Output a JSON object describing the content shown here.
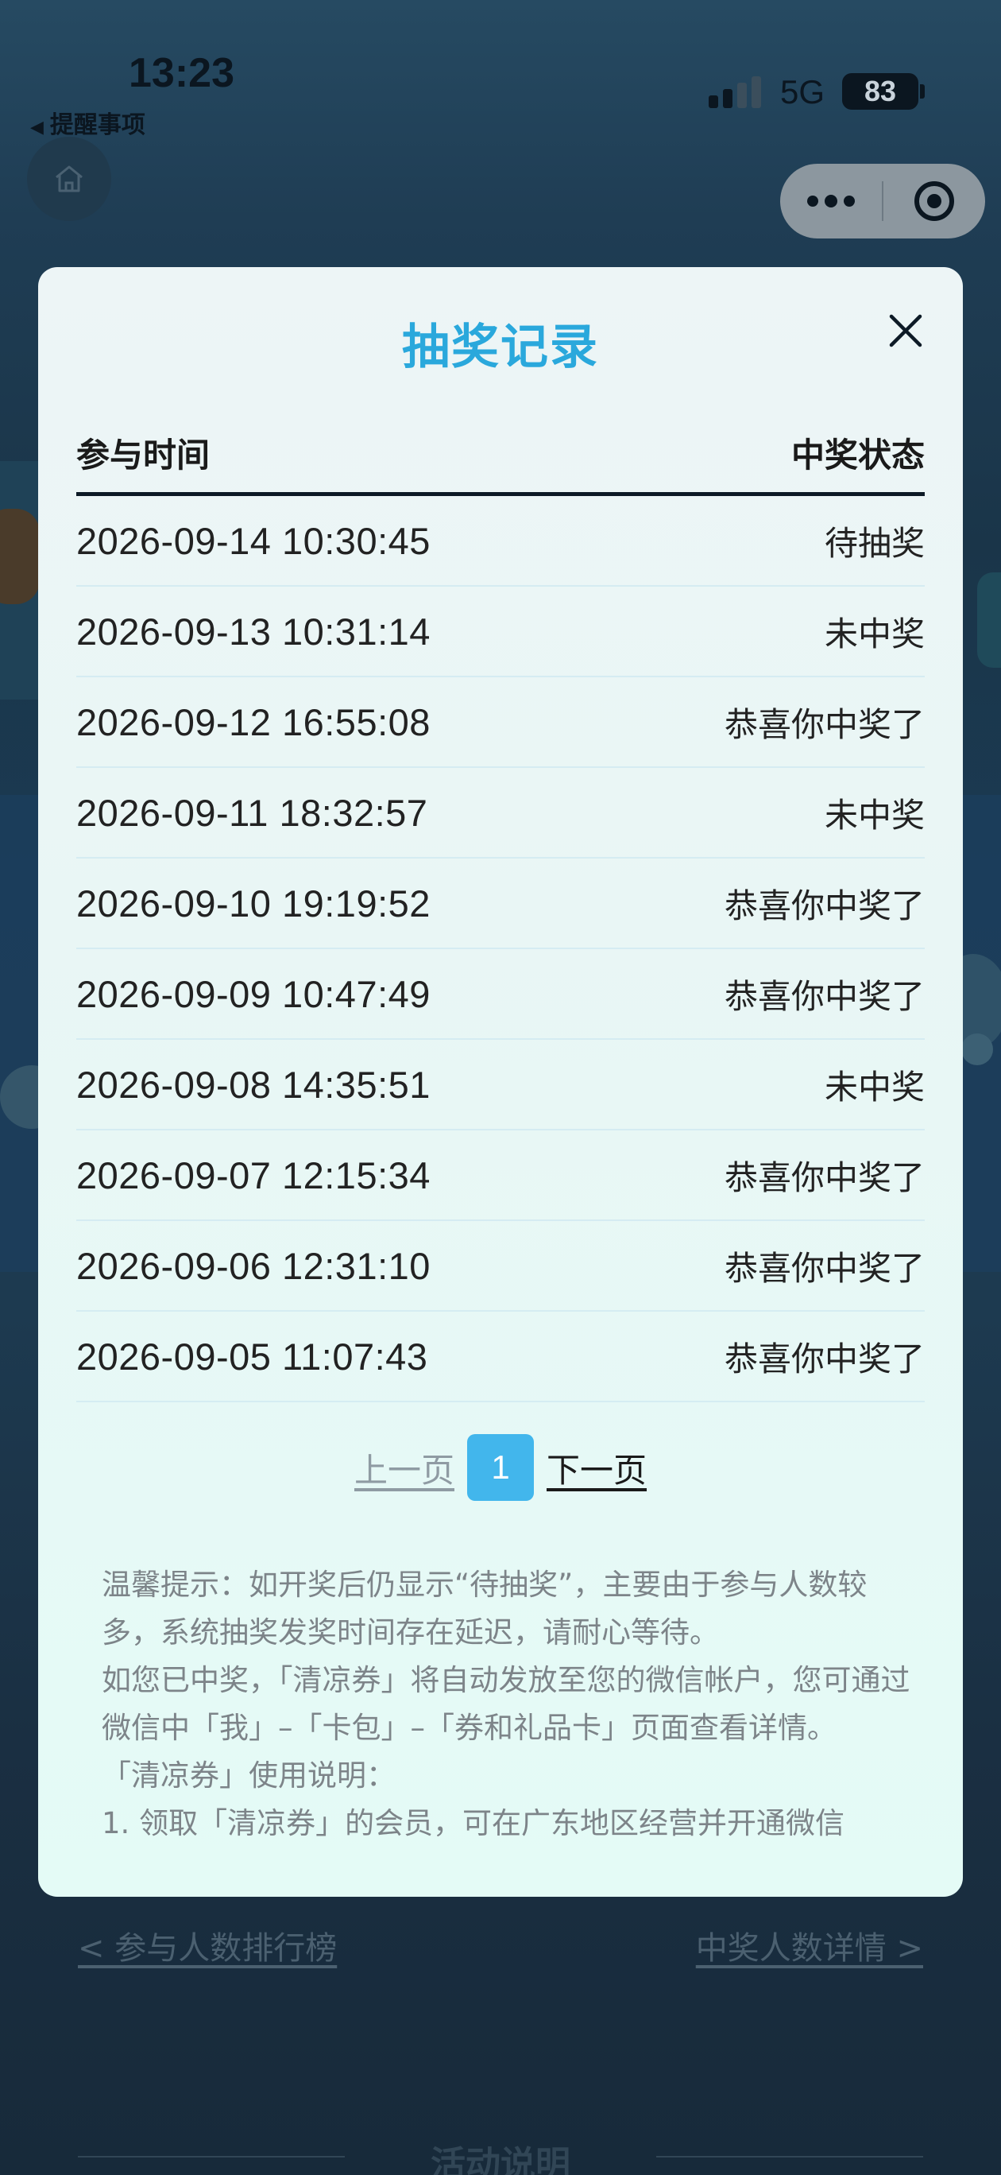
{
  "status_bar": {
    "time": "13:23",
    "back_label": "提醒事项",
    "network": "5G",
    "battery": "83"
  },
  "modal": {
    "title": "抽奖记录",
    "columns": {
      "time": "参与时间",
      "status": "中奖状态"
    },
    "rows": [
      {
        "time": "2026-09-14 10:30:45",
        "status": "待抽奖"
      },
      {
        "time": "2026-09-13 10:31:14",
        "status": "未中奖"
      },
      {
        "time": "2026-09-12 16:55:08",
        "status": "恭喜你中奖了"
      },
      {
        "time": "2026-09-11 18:32:57",
        "status": "未中奖"
      },
      {
        "time": "2026-09-10 19:19:52",
        "status": "恭喜你中奖了"
      },
      {
        "time": "2026-09-09 10:47:49",
        "status": "恭喜你中奖了"
      },
      {
        "time": "2026-09-08 14:35:51",
        "status": "未中奖"
      },
      {
        "time": "2026-09-07 12:15:34",
        "status": "恭喜你中奖了"
      },
      {
        "time": "2026-09-06 12:31:10",
        "status": "恭喜你中奖了"
      },
      {
        "time": "2026-09-05 11:07:43",
        "status": "恭喜你中奖了"
      }
    ],
    "pager": {
      "prev": "上一页",
      "current": "1",
      "next": "下一页"
    },
    "tips": [
      "温馨提示：如开奖后仍显示“待抽奖”，主要由于参与人数较多，系统抽奖发奖时间存在延迟，请耐心等待。",
      "如您已中奖，「清凉券」将自动发放至您的微信帐户，您可通过微信中「我」–「卡包」–「券和礼品卡」页面查看详情。",
      "「清凉券」使用说明：",
      "1. 领取「清凉券」的会员，可在广东地区经营并开通微信"
    ]
  },
  "background": {
    "link_left": "< 参与人数排行榜",
    "link_right": "中奖人数详情 >",
    "section_title": "活动说明"
  },
  "colors": {
    "title_blue": "#2aa8dc",
    "page_badge": "#42b6ec",
    "overlay_bg": "#1c3346"
  },
  "icons": {
    "home": "home-icon",
    "more": "more-dots-icon",
    "close_miniprogram": "target-icon",
    "close_modal": "close-icon"
  }
}
